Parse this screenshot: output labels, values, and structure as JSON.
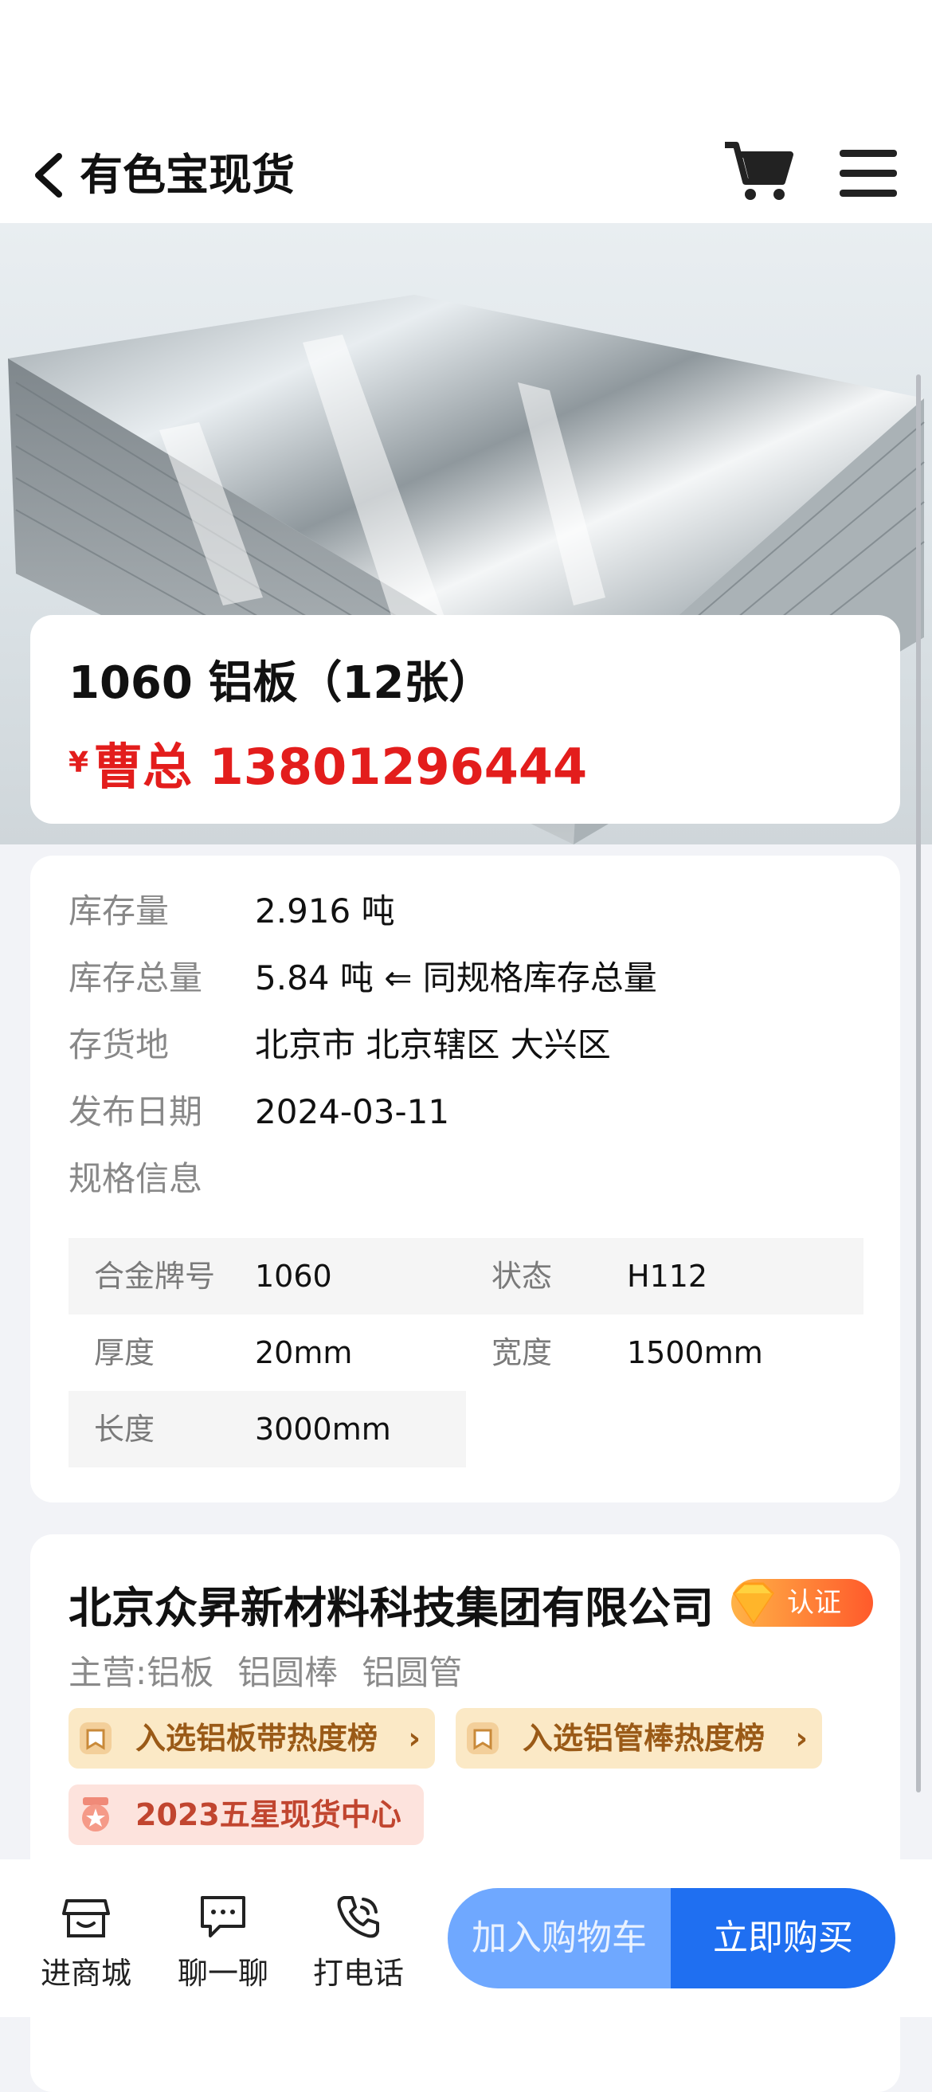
{
  "nav": {
    "title": "有色宝现货"
  },
  "product": {
    "title": "1060 铝板（12张）",
    "price_symbol": "¥",
    "price_text": "曹总 13801296444"
  },
  "info": {
    "rows": [
      {
        "label": "库存量",
        "value": "2.916 吨"
      },
      {
        "label": "库存总量",
        "value": "5.84 吨 ⇐ 同规格库存总量"
      },
      {
        "label": "存货地",
        "value": "北京市 北京辖区 大兴区"
      },
      {
        "label": "发布日期",
        "value": "2024-03-11"
      },
      {
        "label": "规格信息",
        "value": ""
      }
    ],
    "specs": [
      {
        "label": "合金牌号",
        "value": "1060"
      },
      {
        "label": "状态",
        "value": "H112"
      },
      {
        "label": "厚度",
        "value": "20mm"
      },
      {
        "label": "宽度",
        "value": "1500mm"
      },
      {
        "label": "长度",
        "value": "3000mm"
      }
    ]
  },
  "shop": {
    "name": "北京众昇新材料科技集团有限公司",
    "cert_label": "认证",
    "main_label": "主营:",
    "main_items": [
      "铝板",
      "铝圆棒",
      "铝圆管"
    ],
    "badges": [
      "入选铝板带热度榜",
      "入选铝管棒热度榜",
      "2023五星现货中心"
    ]
  },
  "bottom": {
    "store": "进商城",
    "chat": "聊一聊",
    "call": "打电话",
    "add_cart": "加入购物车",
    "buy_now": "立即购买"
  },
  "colors": {
    "price_red": "#e31d1c",
    "primary_blue": "#1f6ff1",
    "light_blue": "#6fa8ff",
    "badge_gold_bg": "#fbe9c6",
    "badge_red_bg": "#fde3dd"
  }
}
